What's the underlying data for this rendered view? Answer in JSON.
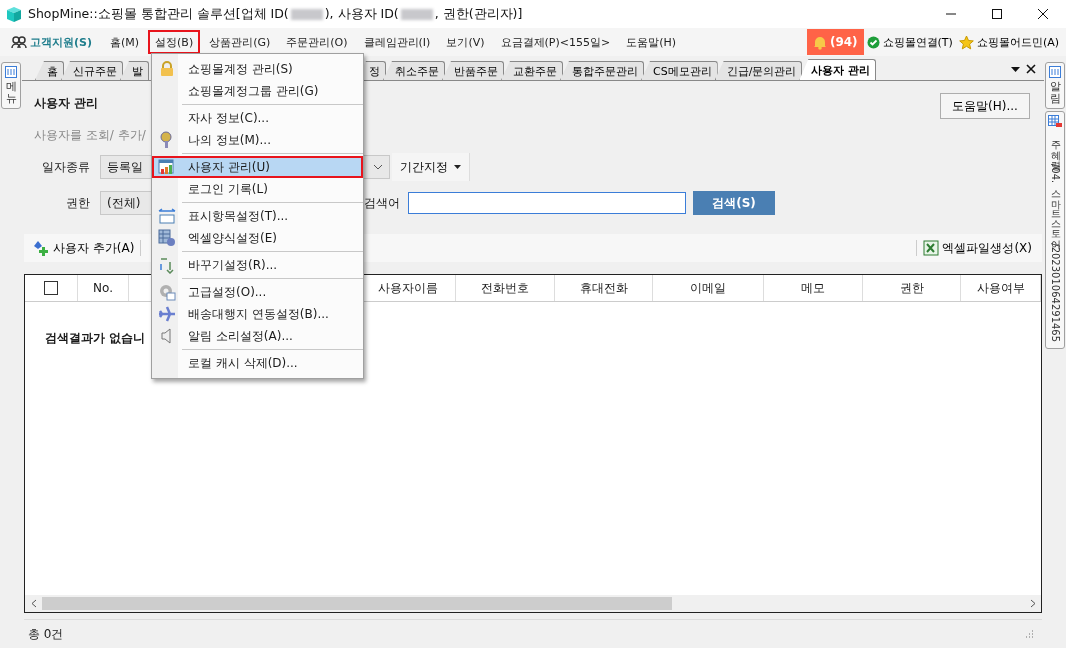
{
  "window": {
    "title_parts": [
      "ShopMine::쇼핑몰 통합관리 솔루션[업체 ID(",
      "), 사용자 ID(",
      ", 권한(관리자)]"
    ]
  },
  "menubar": {
    "items": [
      {
        "label": "고객지원(S)",
        "selected": false
      },
      {
        "label": "홈(M)",
        "selected": false
      },
      {
        "label": "설정(B)",
        "selected": true
      },
      {
        "label": "상품관리(G)",
        "selected": false
      },
      {
        "label": "주문관리(O)",
        "selected": false
      },
      {
        "label": "클레임관리(I)",
        "selected": false
      },
      {
        "label": "보기(V)",
        "selected": false
      },
      {
        "label": "요금결제(P)<155일>",
        "selected": false
      },
      {
        "label": "도움말(H)",
        "selected": false
      }
    ],
    "alert_count": "(94)",
    "connect": "쇼핑몰연결(T)",
    "admin": "쇼핑몰어드민(A)"
  },
  "left_panel_tab": "메뉴",
  "right_panel_tabs": [
    "알림",
    "주혜령/04.스마트스토어/202301064291465"
  ],
  "tabs": [
    {
      "label": "홈",
      "selected": false
    },
    {
      "label": "신규주문",
      "selected": false
    },
    {
      "label": "발",
      "selected": false
    },
    {
      "label": "정",
      "selected": false
    },
    {
      "label": "취소주문",
      "selected": false
    },
    {
      "label": "반품주문",
      "selected": false
    },
    {
      "label": "교환주문",
      "selected": false
    },
    {
      "label": "통합주문관리",
      "selected": false
    },
    {
      "label": "CS메모관리",
      "selected": false
    },
    {
      "label": "긴급/문의관리",
      "selected": false
    },
    {
      "label": "사용자 관리",
      "selected": true
    }
  ],
  "page": {
    "title": "사용자 관리",
    "subtitle": "사용자를 조회/ 추가/",
    "help_button": "도움말(H)...",
    "filters": {
      "date_type_label": "일자종류",
      "date_type_value": "등록일",
      "period_button": "기간지정",
      "role_label": "권한",
      "role_value": "(전체)",
      "keyword_label": "검색어",
      "search_button": "검색(S)"
    }
  },
  "toolbar": {
    "add_user": "사용자 추가(A)",
    "export_excel": "엑셀파일생성(X)"
  },
  "table": {
    "select_all_checked": false,
    "columns": [
      "No.",
      "사용자이름",
      "전화번호",
      "휴대전화",
      "이메일",
      "메모",
      "권한",
      "사용여부"
    ],
    "empty_message": "검색결과가 없습니"
  },
  "status_bar": {
    "total": "총 0건"
  },
  "menu": {
    "sections": [
      [
        {
          "label": "쇼핑몰계정 관리(S)",
          "selected": false
        },
        {
          "label": "쇼핑몰계정그룹 관리(G)",
          "selected": false
        }
      ],
      [
        {
          "label": "자사 정보(C)...",
          "selected": false
        },
        {
          "label": "나의 정보(M)...",
          "selected": false
        }
      ],
      [
        {
          "label": "사용자 관리(U)",
          "selected": true
        },
        {
          "label": "로그인 기록(L)",
          "selected": false
        }
      ],
      [
        {
          "label": "표시항목설정(T)...",
          "selected": false
        },
        {
          "label": "엑셀양식설정(E)",
          "selected": false
        }
      ],
      [
        {
          "label": "바꾸기설정(R)...",
          "selected": false
        }
      ],
      [
        {
          "label": "고급설정(O)...",
          "selected": false
        },
        {
          "label": "배송대행지 연동설정(B)...",
          "selected": false
        },
        {
          "label": "알림 소리설정(A)...",
          "selected": false
        }
      ],
      [
        {
          "label": "로컬 캐시 삭제(D)...",
          "selected": false
        }
      ]
    ]
  }
}
